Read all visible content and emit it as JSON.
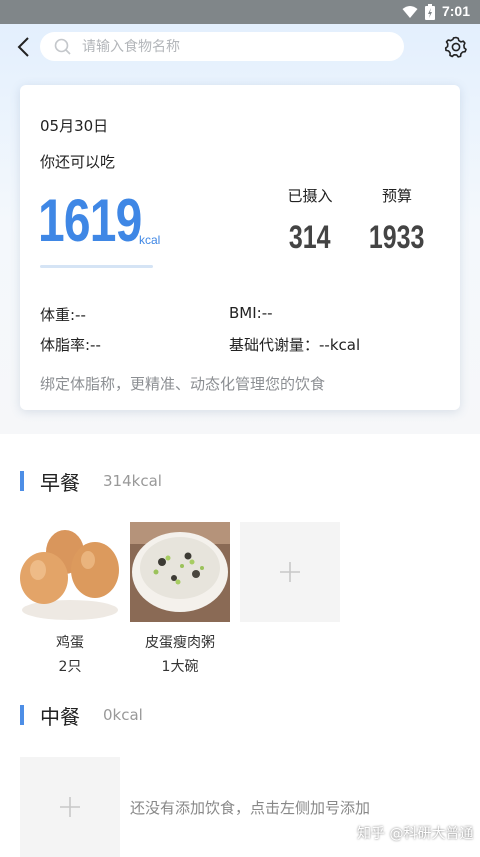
{
  "status_bar": {
    "time": "7:01"
  },
  "search": {
    "placeholder": "请输入食物名称"
  },
  "summary": {
    "date": "05月30日",
    "remain_label": "你还可以吃",
    "remain_value": "1619",
    "remain_unit": "kcal",
    "intake_label": "已摄入",
    "intake_value": "314",
    "budget_label": "预算",
    "budget_value": "1933",
    "weight": "体重:--",
    "bmi": "BMI:--",
    "body_fat": "体脂率:--",
    "bmr": "基础代谢量：--kcal",
    "hint": "绑定体脂称，更精准、动态化管理您的饮食"
  },
  "breakfast": {
    "title": "早餐",
    "kcal": "314kcal",
    "items": [
      {
        "name": "鸡蛋",
        "amount": "2只",
        "icon": "egg-photo"
      },
      {
        "name": "皮蛋瘦肉粥",
        "amount": "1大碗",
        "icon": "porridge-photo"
      }
    ]
  },
  "lunch": {
    "title": "中餐",
    "kcal": "0kcal",
    "empty_text": "还没有添加饮食，点击左侧加号添加"
  },
  "watermark": "知乎 @科研大普通",
  "colors": {
    "accent": "#3f87e5",
    "section_bar": "#4d8ee6"
  }
}
